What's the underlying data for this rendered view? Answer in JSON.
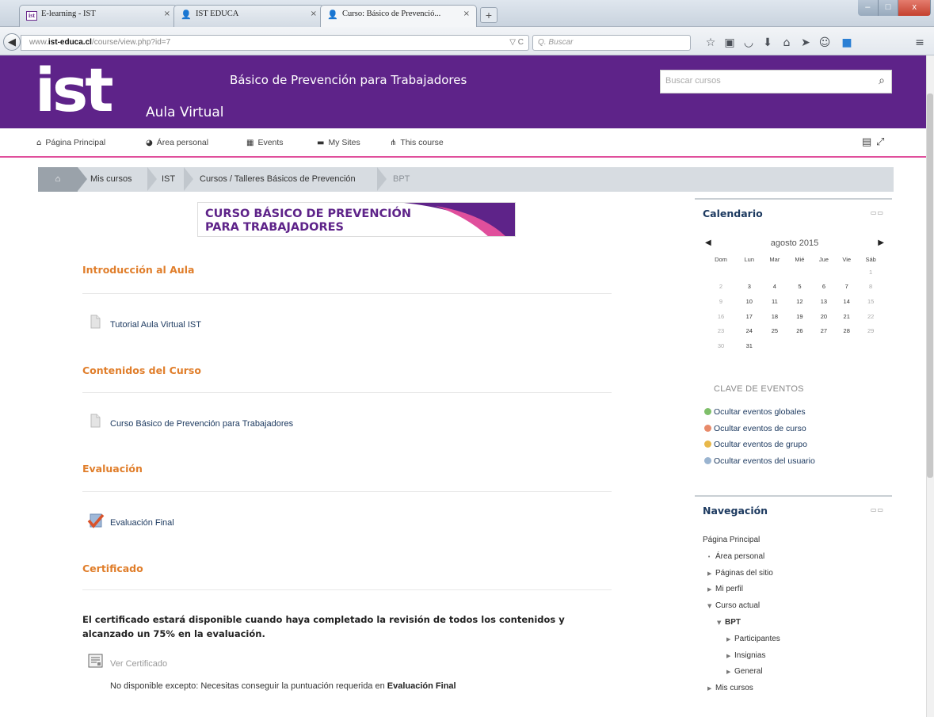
{
  "browser": {
    "tabs": [
      {
        "label": "E-learning - IST",
        "close": "×"
      },
      {
        "label": "IST EDUCA",
        "close": "×"
      },
      {
        "label": "Curso: Básico de Prevenció...",
        "close": "×"
      }
    ],
    "new_tab": "+",
    "url_prefix": "www.",
    "url_domain": "ist-educa.cl",
    "url_path": "/course/view.php?id=7",
    "url_right": "▽ C",
    "search_placeholder": "Q. Buscar",
    "icons": [
      "star-icon",
      "clipboard-icon",
      "pocket-icon",
      "download-icon",
      "home-icon",
      "send-icon",
      "chat-icon",
      "extension-icon",
      "menu-icon"
    ]
  },
  "header": {
    "logo": "ist",
    "subtitle": "Aula Virtual",
    "site_name": "Básico de Prevención para Trabajadores",
    "search_placeholder": "Buscar cursos",
    "search_icon": "🔍"
  },
  "menu": {
    "items": [
      {
        "label": "Página Principal",
        "icon": "home-icon"
      },
      {
        "label": "Área personal",
        "icon": "dashboard-icon"
      },
      {
        "label": "Events",
        "icon": "calendar-icon"
      },
      {
        "label": "My Sites",
        "icon": "briefcase-icon"
      },
      {
        "label": "This course",
        "icon": "sitemap-icon"
      }
    ]
  },
  "breadcrumb": [
    "Mis cursos",
    "IST",
    "Cursos / Talleres Básicos de Prevención",
    "BPT"
  ],
  "banner": {
    "line1": "CURSO BÁSICO DE PREVENCIÓN",
    "line2": "PARA TRABAJADORES"
  },
  "sections": [
    {
      "title": "Introducción al Aula",
      "activity": "Tutorial Aula Virtual IST"
    },
    {
      "title": "Contenidos del Curso",
      "activity": "Curso Básico de Prevención para Trabajadores"
    },
    {
      "title": "Evaluación",
      "activity": "Evaluación Final"
    },
    {
      "title": "Certificado",
      "activity": "Ver Certificado"
    }
  ],
  "certificate": {
    "message": "El certificado estará disponible cuando haya completado la revisión de todos los contenidos y alcanzado un 75% en la evaluación.",
    "not_available_prefix": "No disponible excepto: Necesitas conseguir la puntuación requerida en ",
    "not_available_bold": "Evaluación Final"
  },
  "calendar": {
    "title": "Calendario",
    "month": "agosto 2015",
    "prev": "◀",
    "next": "▶",
    "days": [
      "Dom",
      "Lun",
      "Mar",
      "Mié",
      "Jue",
      "Vie",
      "Sáb"
    ],
    "weeks": [
      [
        "",
        "",
        "",
        "",
        "",
        "",
        "1"
      ],
      [
        "2",
        "3",
        "4",
        "5",
        "6",
        "7",
        "8"
      ],
      [
        "9",
        "10",
        "11",
        "12",
        "13",
        "14",
        "15"
      ],
      [
        "16",
        "17",
        "18",
        "19",
        "20",
        "21",
        "22"
      ],
      [
        "23",
        "24",
        "25",
        "26",
        "27",
        "28",
        "29"
      ],
      [
        "30",
        "31",
        "",
        "",
        "",
        "",
        ""
      ]
    ],
    "key_title": "CLAVE DE EVENTOS",
    "events": [
      {
        "label": "Ocultar eventos globales",
        "color": "#7fbf6a"
      },
      {
        "label": "Ocultar eventos de curso",
        "color": "#e88a6a"
      },
      {
        "label": "Ocultar eventos de grupo",
        "color": "#e8b84a"
      },
      {
        "label": "Ocultar eventos del usuario",
        "color": "#9ab4d0"
      }
    ]
  },
  "navigation": {
    "title": "Navegación",
    "items": [
      {
        "label": "Página Principal",
        "level": 0,
        "marker": ""
      },
      {
        "label": "Área personal",
        "level": 1,
        "marker": "•"
      },
      {
        "label": "Páginas del sitio",
        "level": 1,
        "marker": "▶"
      },
      {
        "label": "Mi perfil",
        "level": 1,
        "marker": "▶"
      },
      {
        "label": "Curso actual",
        "level": 1,
        "marker": "▼"
      },
      {
        "label": "BPT",
        "level": 2,
        "marker": "▼"
      },
      {
        "label": "Participantes",
        "level": 3,
        "marker": "▶"
      },
      {
        "label": "Insignias",
        "level": 3,
        "marker": "▶"
      },
      {
        "label": "General",
        "level": 3,
        "marker": "▶"
      },
      {
        "label": "Mis cursos",
        "level": 1,
        "marker": "▶"
      }
    ]
  },
  "colors": {
    "brand": "#5e2389",
    "accent": "#e07e2b",
    "pink": "#e04f9c"
  }
}
